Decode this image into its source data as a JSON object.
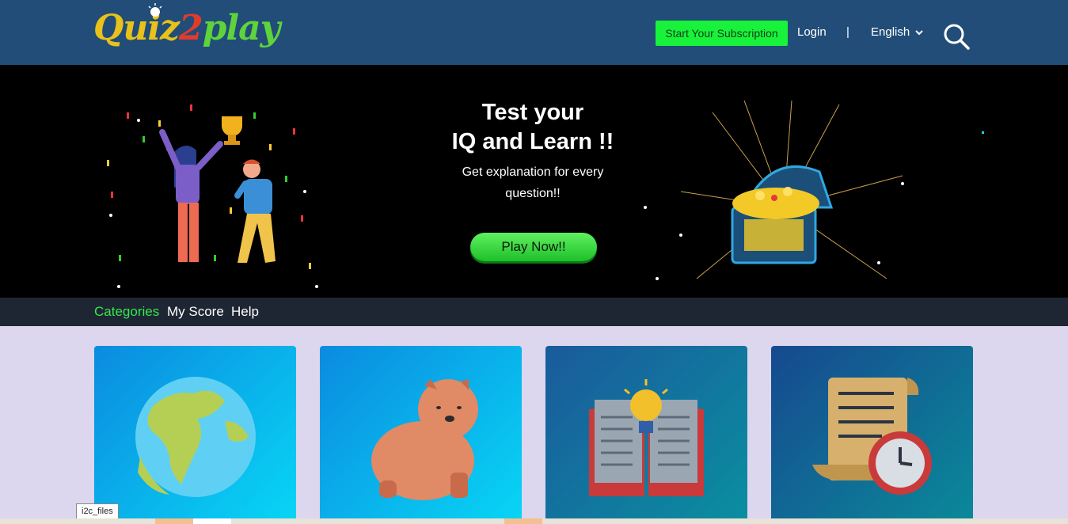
{
  "header": {
    "logo_text_part1": "Quiz",
    "logo_text_part2": "2",
    "logo_text_part3": "play",
    "subscription_label": "Start Your Subscription",
    "login_label": "Login",
    "separator": "|",
    "language_label": "English",
    "search_icon": "search-icon"
  },
  "banner": {
    "title_line1": "Test your",
    "title_line2": "IQ and Learn !!",
    "subtitle_line1": "Get explanation for every",
    "subtitle_line2": "question!!",
    "play_label": "Play Now!!"
  },
  "subnav": {
    "items": [
      {
        "label": "Categories",
        "active": true
      },
      {
        "label": "My Score",
        "active": false
      },
      {
        "label": "Help",
        "active": false
      }
    ]
  },
  "cards": [
    {
      "icon": "globe-icon"
    },
    {
      "icon": "dog-icon"
    },
    {
      "icon": "book-bulb-icon"
    },
    {
      "icon": "scroll-clock-icon"
    }
  ],
  "status_bar": {
    "text": "i2c_files"
  },
  "colors": {
    "header_bg": "#214d78",
    "accent_green": "#19f23a",
    "subnav_bg": "#1f2633",
    "page_bg": "#dcd6ee"
  }
}
